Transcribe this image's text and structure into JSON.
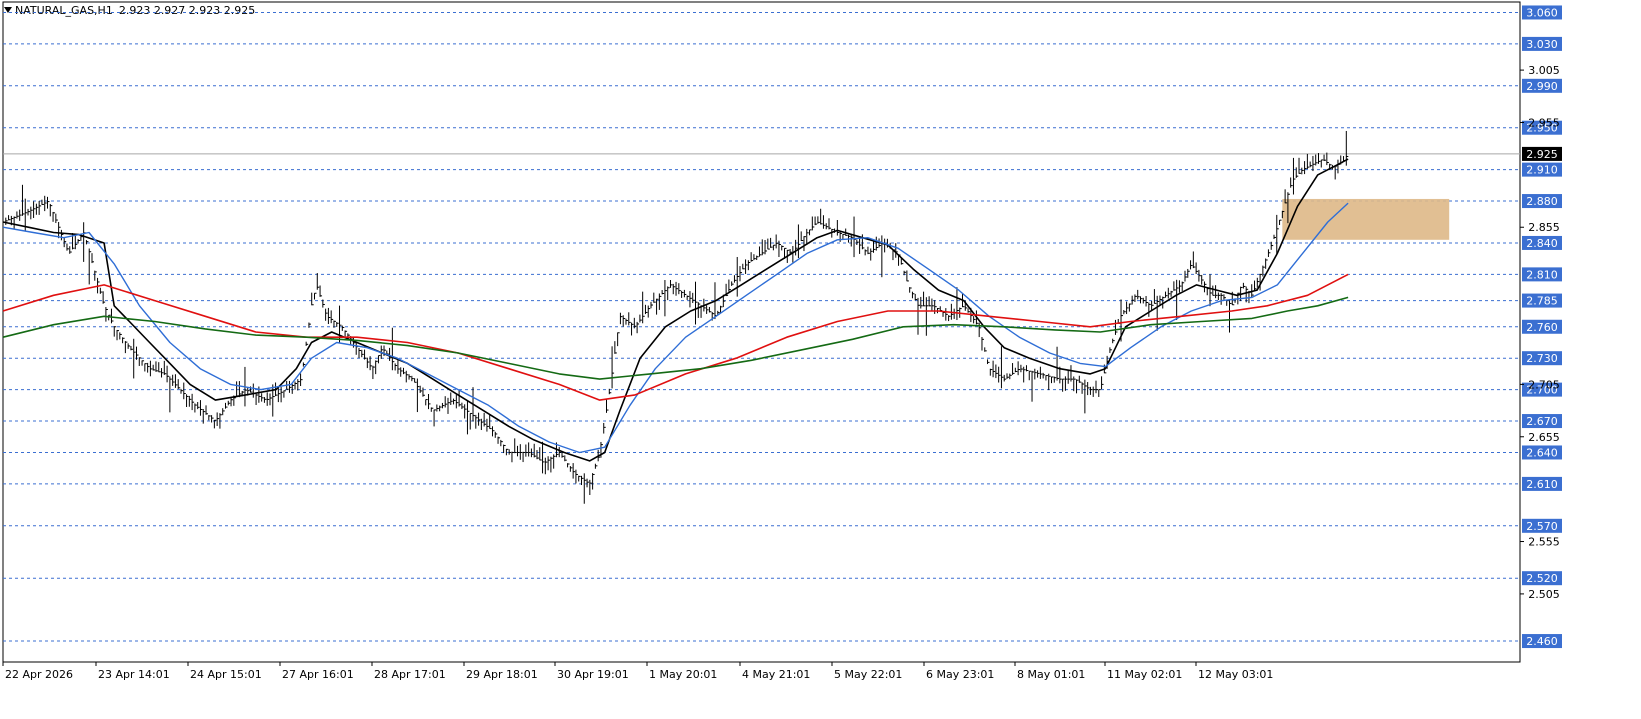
{
  "header": {
    "symbol": "NATURAL_GAS,H1",
    "ohlc": "2.923 2.927 2.923 2.925"
  },
  "colors": {
    "background": "#ffffff",
    "grid_line": "#3b6fd1",
    "label_bg": "#3b6fd1",
    "label_text": "#ffffff",
    "current_price_bg": "#000000",
    "ma_fast": "#000000",
    "ma_mid": "#2f6ed6",
    "ma_slow": "#e01010",
    "ma_long": "#146a14",
    "zone": "#deb887",
    "candles": "#000000"
  },
  "chart_data": {
    "type": "line",
    "title": "NATURAL_GAS,H1",
    "ylim": [
      2.44,
      3.07
    ],
    "y_axis_labels": [
      "3.005",
      "2.955",
      "2.855",
      "2.705",
      "2.655",
      "2.555",
      "2.505"
    ],
    "horizontal_levels": [
      "3.060",
      "3.030",
      "2.990",
      "2.950",
      "2.910",
      "2.880",
      "2.840",
      "2.810",
      "2.785",
      "2.760",
      "2.730",
      "2.700",
      "2.670",
      "2.640",
      "2.610",
      "2.570",
      "2.520",
      "2.460"
    ],
    "current_price": "2.925",
    "x_tick_labels": [
      "22 Apr 2026",
      "23 Apr 14:01",
      "24 Apr 15:01",
      "27 Apr 16:01",
      "28 Apr 17:01",
      "29 Apr 18:01",
      "30 Apr 19:01",
      "1 May 20:01",
      "4 May 21:01",
      "5 May 22:01",
      "6 May 23:01",
      "8 May 01:01",
      "11 May 02:01",
      "12 May 03:01"
    ],
    "price_path": [
      [
        0,
        2.86
      ],
      [
        10,
        2.87
      ],
      [
        18,
        2.88
      ],
      [
        22,
        2.855
      ],
      [
        26,
        2.83
      ],
      [
        32,
        2.85
      ],
      [
        40,
        2.78
      ],
      [
        44,
        2.76
      ],
      [
        50,
        2.74
      ],
      [
        58,
        2.72
      ],
      [
        64,
        2.715
      ],
      [
        70,
        2.7
      ],
      [
        76,
        2.685
      ],
      [
        84,
        2.67
      ],
      [
        90,
        2.69
      ],
      [
        96,
        2.7
      ],
      [
        104,
        2.69
      ],
      [
        112,
        2.7
      ],
      [
        118,
        2.71
      ],
      [
        122,
        2.78
      ],
      [
        124,
        2.8
      ],
      [
        128,
        2.77
      ],
      [
        134,
        2.76
      ],
      [
        140,
        2.74
      ],
      [
        146,
        2.72
      ],
      [
        150,
        2.74
      ],
      [
        156,
        2.72
      ],
      [
        162,
        2.71
      ],
      [
        170,
        2.68
      ],
      [
        178,
        2.69
      ],
      [
        186,
        2.675
      ],
      [
        194,
        2.66
      ],
      [
        200,
        2.64
      ],
      [
        208,
        2.64
      ],
      [
        214,
        2.63
      ],
      [
        220,
        2.64
      ],
      [
        226,
        2.62
      ],
      [
        232,
        2.61
      ],
      [
        236,
        2.64
      ],
      [
        240,
        2.7
      ],
      [
        244,
        2.77
      ],
      [
        250,
        2.76
      ],
      [
        256,
        2.78
      ],
      [
        264,
        2.8
      ],
      [
        270,
        2.79
      ],
      [
        276,
        2.78
      ],
      [
        282,
        2.77
      ],
      [
        288,
        2.8
      ],
      [
        294,
        2.82
      ],
      [
        300,
        2.83
      ],
      [
        306,
        2.84
      ],
      [
        312,
        2.83
      ],
      [
        318,
        2.85
      ],
      [
        322,
        2.86
      ],
      [
        326,
        2.855
      ],
      [
        330,
        2.85
      ],
      [
        336,
        2.845
      ],
      [
        342,
        2.83
      ],
      [
        348,
        2.84
      ],
      [
        354,
        2.83
      ],
      [
        358,
        2.8
      ],
      [
        362,
        2.78
      ],
      [
        368,
        2.78
      ],
      [
        374,
        2.77
      ],
      [
        380,
        2.78
      ],
      [
        386,
        2.76
      ],
      [
        390,
        2.72
      ],
      [
        396,
        2.71
      ],
      [
        402,
        2.72
      ],
      [
        410,
        2.715
      ],
      [
        418,
        2.71
      ],
      [
        424,
        2.71
      ],
      [
        430,
        2.7
      ],
      [
        434,
        2.7
      ],
      [
        438,
        2.74
      ],
      [
        442,
        2.77
      ],
      [
        448,
        2.79
      ],
      [
        454,
        2.78
      ],
      [
        460,
        2.79
      ],
      [
        466,
        2.8
      ],
      [
        470,
        2.82
      ],
      [
        474,
        2.805
      ],
      [
        478,
        2.79
      ],
      [
        482,
        2.79
      ],
      [
        486,
        2.78
      ],
      [
        490,
        2.8
      ],
      [
        494,
        2.79
      ],
      [
        498,
        2.815
      ],
      [
        502,
        2.84
      ],
      [
        506,
        2.87
      ],
      [
        510,
        2.9
      ],
      [
        514,
        2.91
      ],
      [
        518,
        2.915
      ],
      [
        522,
        2.92
      ],
      [
        526,
        2.912
      ],
      [
        530,
        2.918
      ],
      [
        532,
        2.925
      ]
    ],
    "series": [
      {
        "name": "",
        "color": "#000000",
        "width": 1.6,
        "values": [
          [
            0,
            2.86
          ],
          [
            10,
            2.855
          ],
          [
            20,
            2.85
          ],
          [
            30,
            2.848
          ],
          [
            40,
            2.84
          ],
          [
            44,
            2.78
          ],
          [
            50,
            2.765
          ],
          [
            58,
            2.745
          ],
          [
            66,
            2.725
          ],
          [
            74,
            2.705
          ],
          [
            84,
            2.69
          ],
          [
            96,
            2.695
          ],
          [
            108,
            2.7
          ],
          [
            116,
            2.72
          ],
          [
            122,
            2.745
          ],
          [
            130,
            2.755
          ],
          [
            140,
            2.745
          ],
          [
            150,
            2.735
          ],
          [
            160,
            2.725
          ],
          [
            170,
            2.71
          ],
          [
            180,
            2.695
          ],
          [
            190,
            2.68
          ],
          [
            200,
            2.665
          ],
          [
            210,
            2.652
          ],
          [
            222,
            2.64
          ],
          [
            232,
            2.632
          ],
          [
            238,
            2.64
          ],
          [
            244,
            2.68
          ],
          [
            252,
            2.73
          ],
          [
            262,
            2.76
          ],
          [
            272,
            2.775
          ],
          [
            282,
            2.785
          ],
          [
            292,
            2.8
          ],
          [
            302,
            2.815
          ],
          [
            312,
            2.83
          ],
          [
            322,
            2.845
          ],
          [
            330,
            2.852
          ],
          [
            340,
            2.845
          ],
          [
            350,
            2.838
          ],
          [
            360,
            2.815
          ],
          [
            370,
            2.795
          ],
          [
            380,
            2.785
          ],
          [
            388,
            2.76
          ],
          [
            396,
            2.74
          ],
          [
            406,
            2.73
          ],
          [
            418,
            2.72
          ],
          [
            430,
            2.715
          ],
          [
            436,
            2.72
          ],
          [
            444,
            2.76
          ],
          [
            454,
            2.775
          ],
          [
            464,
            2.79
          ],
          [
            472,
            2.8
          ],
          [
            480,
            2.795
          ],
          [
            488,
            2.79
          ],
          [
            496,
            2.795
          ],
          [
            504,
            2.83
          ],
          [
            512,
            2.875
          ],
          [
            520,
            2.905
          ],
          [
            528,
            2.915
          ],
          [
            532,
            2.92
          ]
        ]
      },
      {
        "name": "",
        "color": "#2f6ed6",
        "width": 1.4,
        "values": [
          [
            0,
            2.855
          ],
          [
            12,
            2.85
          ],
          [
            24,
            2.845
          ],
          [
            34,
            2.85
          ],
          [
            44,
            2.82
          ],
          [
            54,
            2.78
          ],
          [
            66,
            2.745
          ],
          [
            78,
            2.72
          ],
          [
            90,
            2.705
          ],
          [
            102,
            2.7
          ],
          [
            114,
            2.705
          ],
          [
            122,
            2.73
          ],
          [
            132,
            2.745
          ],
          [
            144,
            2.74
          ],
          [
            156,
            2.73
          ],
          [
            168,
            2.715
          ],
          [
            180,
            2.7
          ],
          [
            192,
            2.685
          ],
          [
            204,
            2.665
          ],
          [
            216,
            2.65
          ],
          [
            228,
            2.64
          ],
          [
            238,
            2.645
          ],
          [
            248,
            2.685
          ],
          [
            258,
            2.72
          ],
          [
            270,
            2.75
          ],
          [
            282,
            2.77
          ],
          [
            294,
            2.79
          ],
          [
            306,
            2.81
          ],
          [
            318,
            2.83
          ],
          [
            330,
            2.843
          ],
          [
            342,
            2.845
          ],
          [
            354,
            2.835
          ],
          [
            366,
            2.815
          ],
          [
            378,
            2.795
          ],
          [
            390,
            2.77
          ],
          [
            402,
            2.75
          ],
          [
            414,
            2.735
          ],
          [
            426,
            2.725
          ],
          [
            436,
            2.722
          ],
          [
            446,
            2.74
          ],
          [
            458,
            2.76
          ],
          [
            470,
            2.775
          ],
          [
            482,
            2.785
          ],
          [
            494,
            2.788
          ],
          [
            504,
            2.8
          ],
          [
            514,
            2.83
          ],
          [
            524,
            2.86
          ],
          [
            532,
            2.878
          ]
        ]
      },
      {
        "name": "",
        "color": "#e01010",
        "width": 1.6,
        "values": [
          [
            0,
            2.775
          ],
          [
            20,
            2.79
          ],
          [
            40,
            2.8
          ],
          [
            60,
            2.785
          ],
          [
            80,
            2.77
          ],
          [
            100,
            2.755
          ],
          [
            120,
            2.75
          ],
          [
            140,
            2.75
          ],
          [
            160,
            2.745
          ],
          [
            180,
            2.735
          ],
          [
            200,
            2.72
          ],
          [
            220,
            2.705
          ],
          [
            236,
            2.69
          ],
          [
            250,
            2.695
          ],
          [
            270,
            2.715
          ],
          [
            290,
            2.73
          ],
          [
            310,
            2.75
          ],
          [
            330,
            2.765
          ],
          [
            350,
            2.775
          ],
          [
            370,
            2.775
          ],
          [
            390,
            2.77
          ],
          [
            410,
            2.765
          ],
          [
            430,
            2.76
          ],
          [
            446,
            2.765
          ],
          [
            466,
            2.77
          ],
          [
            486,
            2.775
          ],
          [
            500,
            2.78
          ],
          [
            516,
            2.79
          ],
          [
            532,
            2.81
          ]
        ]
      },
      {
        "name": "",
        "color": "#146a14",
        "width": 1.6,
        "values": [
          [
            0,
            2.75
          ],
          [
            20,
            2.762
          ],
          [
            40,
            2.77
          ],
          [
            60,
            2.765
          ],
          [
            80,
            2.758
          ],
          [
            100,
            2.752
          ],
          [
            120,
            2.75
          ],
          [
            140,
            2.747
          ],
          [
            160,
            2.742
          ],
          [
            180,
            2.735
          ],
          [
            200,
            2.725
          ],
          [
            220,
            2.715
          ],
          [
            236,
            2.71
          ],
          [
            256,
            2.715
          ],
          [
            276,
            2.72
          ],
          [
            296,
            2.728
          ],
          [
            316,
            2.738
          ],
          [
            336,
            2.748
          ],
          [
            356,
            2.76
          ],
          [
            376,
            2.762
          ],
          [
            396,
            2.76
          ],
          [
            416,
            2.757
          ],
          [
            434,
            2.755
          ],
          [
            454,
            2.762
          ],
          [
            474,
            2.765
          ],
          [
            494,
            2.768
          ],
          [
            508,
            2.775
          ],
          [
            520,
            2.78
          ],
          [
            532,
            2.788
          ]
        ]
      }
    ],
    "zone": {
      "x_from": 506,
      "x_to": 572,
      "y_from": 2.843,
      "y_to": 2.882
    },
    "x_range": [
      0,
      600
    ],
    "grid": "horizontal dashed lines at marked levels",
    "legend": "none"
  }
}
